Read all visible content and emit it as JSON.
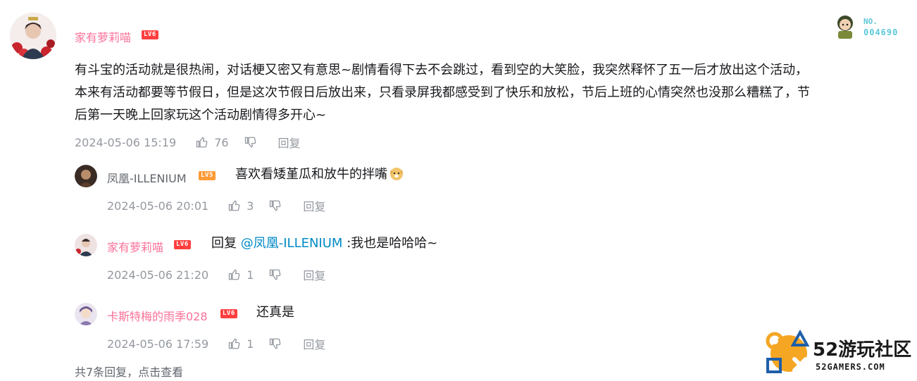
{
  "main_comment": {
    "user": "家有萝莉喵",
    "level": "LV6",
    "badge_label": "NO.",
    "badge_number": "004690",
    "lines": [
      "有斗宝的活动就是很热闹，对话梗又密又有意思~剧情看得下去不会跳过，看到空的大笑脸，我突然释怀了五一后才放出这个活动，",
      "本来有活动都要等节假日，但是这次节假日后放出来，只看录屏我都感受到了快乐和放松，节后上班的心情突然也没那么糟糕了，节",
      "后第一天晚上回家玩这个活动剧情得多开心~"
    ],
    "date": "2024-05-06 15:19",
    "likes": "76",
    "reply_label": "回复"
  },
  "replies": [
    {
      "user": "凤凰-ILLENIUM",
      "level": "LV5",
      "text": "喜欢看矮堇瓜和放牛的拌嘴",
      "date": "2024-05-06 20:01",
      "likes": "3",
      "reply_label": "回复"
    },
    {
      "user": "家有萝莉喵",
      "level": "LV6",
      "prefix": "回复",
      "mention": "@凤凰-ILLENIUM",
      "text": ":我也是哈哈哈~",
      "date": "2024-05-06 21:20",
      "likes": "1",
      "reply_label": "回复"
    },
    {
      "user": "卡斯特梅的雨季028",
      "level": "LV6",
      "text": "还真是",
      "date": "2024-05-06 17:59",
      "likes": "1",
      "reply_label": "回复"
    }
  ],
  "footer": {
    "summary": "共7条回复，点击查看"
  },
  "watermark": {
    "title": "52游玩社区",
    "url": "52GAMERS.COM"
  },
  "colors": {
    "pink_name": "#fb7299",
    "gray_name": "#61666d",
    "meta": "#9499a0",
    "link": "#008ac5",
    "logo_orange": "#f5a623",
    "logo_blue": "#1f5fa8"
  }
}
